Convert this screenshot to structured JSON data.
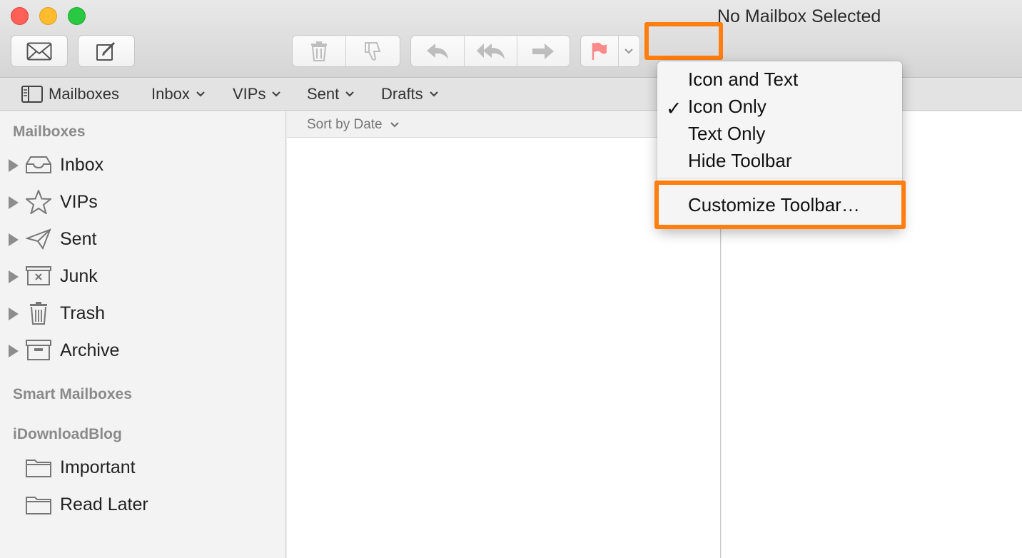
{
  "window": {
    "title": "No Mailbox Selected"
  },
  "toolbar": {
    "get_mail_icon": "envelope-icon",
    "compose_icon": "compose-icon",
    "delete_icon": "trash-icon",
    "junk_icon": "thumbs-down-icon",
    "reply_icon": "reply-icon",
    "reply_all_icon": "reply-all-icon",
    "forward_icon": "forward-icon",
    "flag_icon": "flag-icon",
    "flag_color": "#fd8a8a",
    "accent_color": "#ff7e0e"
  },
  "favorites": {
    "mailboxes": "Mailboxes",
    "inbox": "Inbox",
    "vips": "VIPs",
    "sent": "Sent",
    "drafts": "Drafts"
  },
  "sidebar": {
    "sections": {
      "mailboxes": "Mailboxes",
      "smart": "Smart Mailboxes",
      "account": "iDownloadBlog"
    },
    "mailboxes": [
      {
        "label": "Inbox",
        "icon": "inbox-tray-icon"
      },
      {
        "label": "VIPs",
        "icon": "star-icon"
      },
      {
        "label": "Sent",
        "icon": "paper-plane-icon"
      },
      {
        "label": "Junk",
        "icon": "junk-box-icon"
      },
      {
        "label": "Trash",
        "icon": "trash-icon"
      },
      {
        "label": "Archive",
        "icon": "archive-box-icon"
      }
    ],
    "account_folders": [
      {
        "label": "Important",
        "icon": "folder-icon"
      },
      {
        "label": "Read Later",
        "icon": "folder-icon"
      }
    ]
  },
  "list": {
    "sort_label": "Sort by Date"
  },
  "context_menu": {
    "items": [
      "Icon and Text",
      "Icon Only",
      "Text Only",
      "Hide Toolbar"
    ],
    "checked": "Icon Only",
    "checkmark": "✓",
    "customize": "Customize Toolbar…"
  }
}
